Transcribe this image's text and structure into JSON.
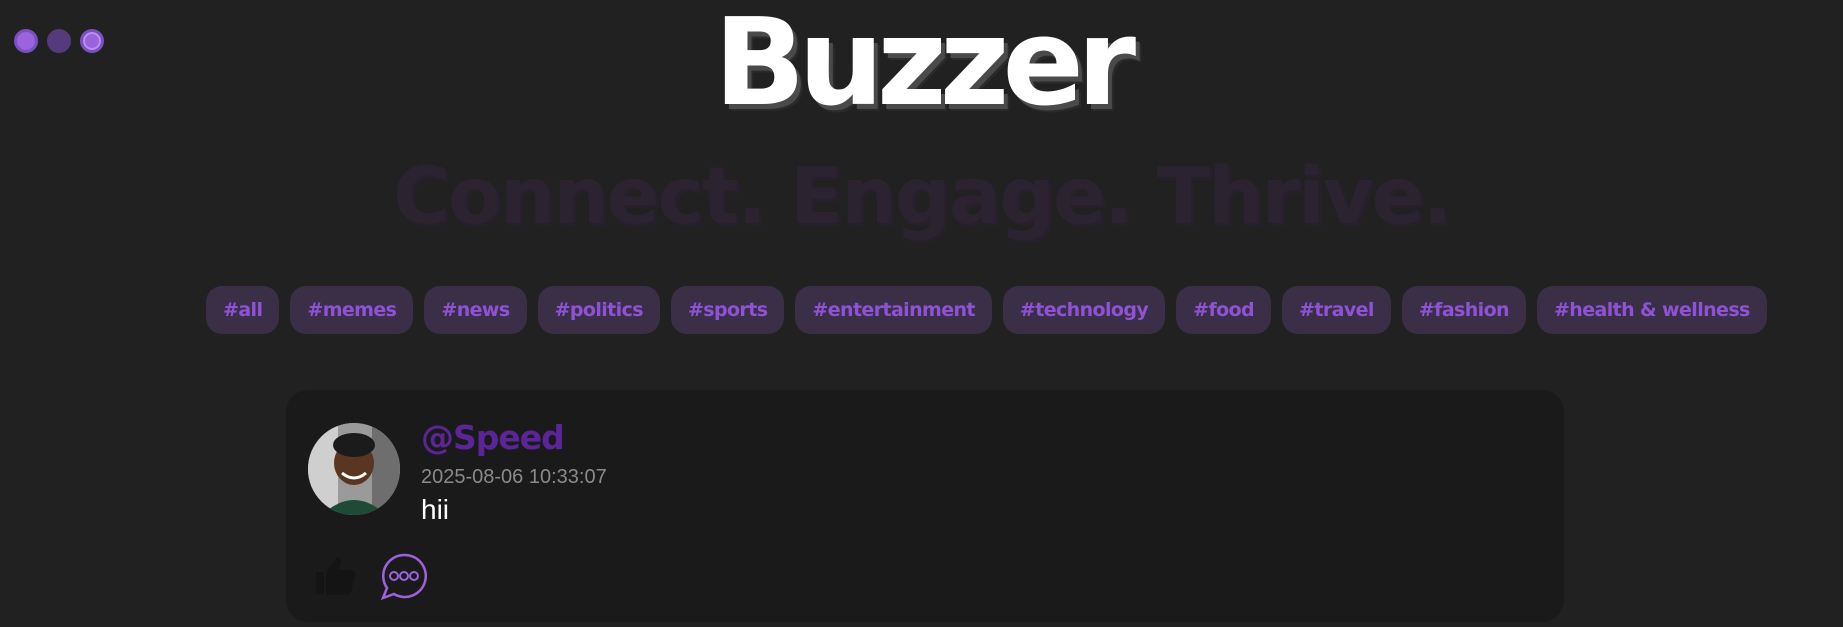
{
  "window_controls": [
    "close",
    "minimize",
    "maximize"
  ],
  "brand": {
    "title": "Buzzer",
    "tagline": "Connect. Engage. Thrive."
  },
  "tags": [
    "#all",
    "#memes",
    "#news",
    "#politics",
    "#sports",
    "#entertainment",
    "#technology",
    "#food",
    "#travel",
    "#fashion",
    "#health & wellness"
  ],
  "post": {
    "username": "@Speed",
    "timestamp": "2025-08-06 10:33:07",
    "text": "hii",
    "like_icon": "thumbs-up-icon",
    "comment_icon": "chat-bubble-icon"
  },
  "colors": {
    "background": "#212121",
    "accent": "#8f52d6",
    "username": "#5b2598",
    "tag_bg": "#3b2f47",
    "card_bg": "#1a1a1a"
  }
}
